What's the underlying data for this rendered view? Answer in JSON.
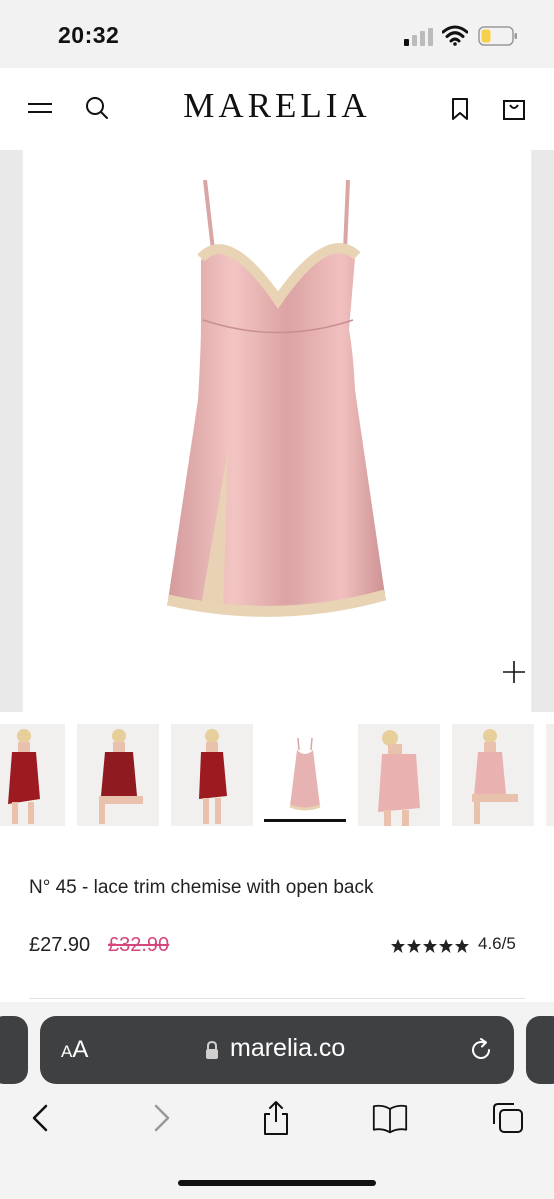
{
  "status_bar": {
    "time": "20:32",
    "battery_color": "#f7d04b"
  },
  "header": {
    "logo": "MARELIA",
    "icons": [
      "menu-icon",
      "search-icon",
      "bookmark-icon",
      "shopping-bag-icon"
    ]
  },
  "gallery": {
    "main_image": "pink satin chemise with lace trim",
    "zoom_icon": "plus-icon",
    "thumbnails": [
      {
        "label": "red chemise front"
      },
      {
        "label": "red chemise seated"
      },
      {
        "label": "red chemise standing"
      },
      {
        "label": "pink chemise flat",
        "active": true
      },
      {
        "label": "pink chemise model"
      },
      {
        "label": "pink chemise seated"
      }
    ]
  },
  "product": {
    "title": "N° 45 - lace trim chemise with open back",
    "price": "£27.90",
    "old_price": "£32.90",
    "rating": "4.6/5",
    "rating_stars": 5,
    "accent_color": "#d4477e"
  },
  "browser": {
    "aa_label_small": "A",
    "aa_label_large": "A",
    "url": "marelia.co",
    "nav_icons": [
      "back-icon",
      "forward-icon",
      "share-icon",
      "bookmarks-icon",
      "tabs-icon"
    ]
  }
}
